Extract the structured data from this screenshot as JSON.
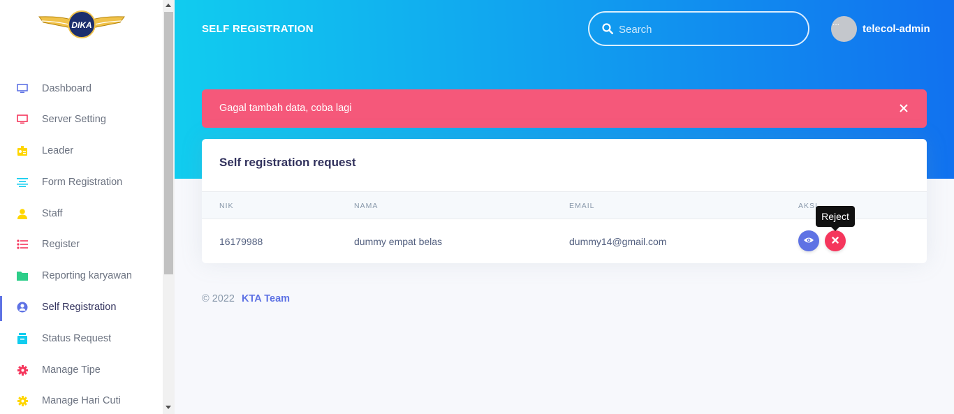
{
  "brand": {
    "logo_text": "DIKA"
  },
  "sidebar": {
    "items": [
      {
        "label": "Dashboard",
        "icon": "monitor-icon",
        "color": "#5e72e4",
        "active": false
      },
      {
        "label": "Server Setting",
        "icon": "monitor-icon",
        "color": "#f5365c",
        "active": false
      },
      {
        "label": "Leader",
        "icon": "id-card-icon",
        "color": "#ffd600",
        "active": false
      },
      {
        "label": "Form Registration",
        "icon": "align-center-icon",
        "color": "#11cdef",
        "active": false
      },
      {
        "label": "Staff",
        "icon": "user-icon",
        "color": "#ffd600",
        "active": false
      },
      {
        "label": "Register",
        "icon": "bullet-list-icon",
        "color": "#f5365c",
        "active": false
      },
      {
        "label": "Reporting karyawan",
        "icon": "folder-icon",
        "color": "#2dce89",
        "active": false
      },
      {
        "label": "Self Registration",
        "icon": "user-circle-icon",
        "color": "#5e72e4",
        "active": true
      },
      {
        "label": "Status Request",
        "icon": "archive-icon",
        "color": "#11cdef",
        "active": false
      },
      {
        "label": "Manage Tipe",
        "icon": "gear-icon",
        "color": "#f5365c",
        "active": false
      },
      {
        "label": "Manage Hari Cuti",
        "icon": "gear-icon",
        "color": "#ffd600",
        "active": false
      }
    ]
  },
  "header": {
    "title": "SELF REGISTRATION",
    "search_placeholder": "Search",
    "avatar_alt": "...",
    "username": "telecol-admin"
  },
  "alert": {
    "message": "Gagal tambah data, coba lagi",
    "color": "#f5587a"
  },
  "card": {
    "title": "Self registration request",
    "columns": [
      "NIK",
      "NAMA",
      "EMAIL",
      "AKSI"
    ],
    "rows": [
      {
        "nik": "16179988",
        "nama": "dummy empat belas",
        "email": "dummy14@gmail.com"
      }
    ]
  },
  "tooltip": {
    "text": "Reject"
  },
  "footer": {
    "copyright": "© 2022",
    "team": "KTA Team"
  },
  "colors": {
    "primary": "#5e72e4",
    "danger": "#f5365c",
    "header_from": "#11cdef",
    "header_to": "#1171ef"
  }
}
